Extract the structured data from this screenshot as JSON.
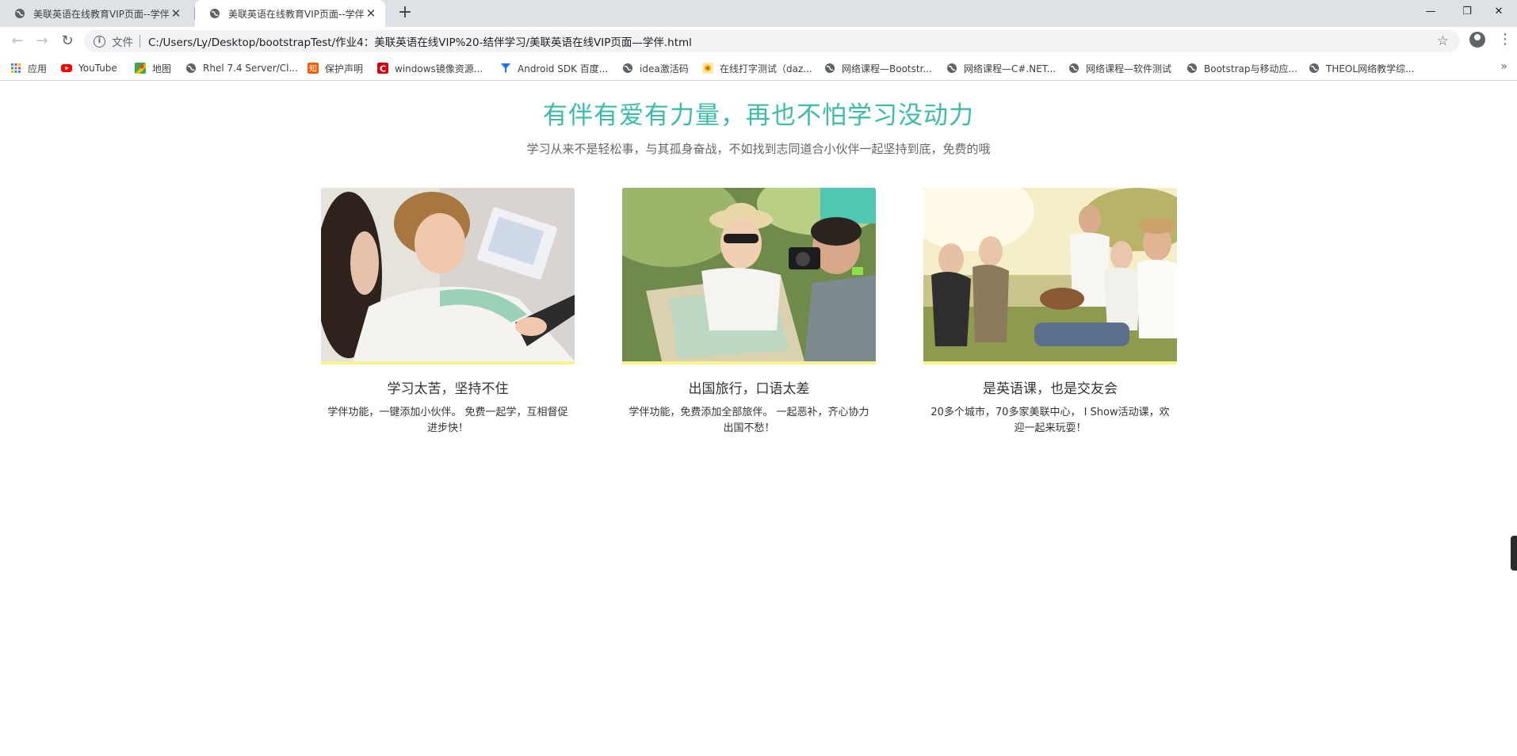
{
  "browser": {
    "tabs": [
      {
        "title": "美联英语在线教育VIP页面--学伴",
        "active": false
      },
      {
        "title": "美联英语在线教育VIP页面--学伴",
        "active": true
      }
    ],
    "new_tab_icon": "plus-icon",
    "window_controls": {
      "minimize": "—",
      "restore": "❐",
      "close": "✕"
    },
    "nav": {
      "back": "←",
      "forward": "→",
      "reload": "↻"
    },
    "address": {
      "info_glyph": "i",
      "scheme_label": "文件",
      "url": "C:/Users/Ly/Desktop/bootstrapTest/作业4：美联英语在线VIP%20-结伴学习/美联英语在线VIP页面—学伴.html"
    },
    "bookmarks": [
      {
        "label": "应用",
        "icon": "apps-grid-icon",
        "color": "#e94235"
      },
      {
        "label": "YouTube",
        "icon": "youtube-icon",
        "color": "#ff0000"
      },
      {
        "label": "地图",
        "icon": "maps-icon",
        "color": "#34a853"
      },
      {
        "label": "Rhel 7.4 Server/Cl...",
        "icon": "globe-icon",
        "color": "#5f6368"
      },
      {
        "label": "保护声明",
        "icon": "shield-icon",
        "color": "#f25c05"
      },
      {
        "label": "windows镜像资源...",
        "icon": "c-logo-icon",
        "color": "#d4000f"
      },
      {
        "label": "Android SDK 百度...",
        "icon": "funnel-icon",
        "color": "#1a73e8"
      },
      {
        "label": "idea激活码",
        "icon": "globe-icon",
        "color": "#5f6368"
      },
      {
        "label": "在线打字测试（daz...",
        "icon": "typing-icon",
        "color": "#f4b400"
      },
      {
        "label": "网络课程—Bootstr...",
        "icon": "globe-icon",
        "color": "#5f6368"
      },
      {
        "label": "网络课程—C#.NET...",
        "icon": "globe-icon",
        "color": "#5f6368"
      },
      {
        "label": "网络课程—软件测试",
        "icon": "globe-icon",
        "color": "#5f6368"
      },
      {
        "label": "Bootstrap与移动应...",
        "icon": "globe-icon",
        "color": "#5f6368"
      },
      {
        "label": "THEOL网络教学综...",
        "icon": "globe-icon",
        "color": "#5f6368"
      }
    ],
    "bookmarks_more": "»"
  },
  "page": {
    "headline": "有伴有爱有力量，再也不怕学习没动力",
    "subline": "学习从来不是轻松事，与其孤身奋战，不如找到志同道合小伙伴一起坚持到底，免费的哦",
    "cards": [
      {
        "title": "学习太苦，坚持不住",
        "desc": "学伴功能，一键添加小伙伴。 免费一起学，互相督促进步快！",
        "photo": "students-studying-photo"
      },
      {
        "title": "出国旅行，口语太差",
        "desc": "学伴功能，免费添加全部旅伴。 一起恶补，齐心协力出国不愁！",
        "photo": "travelers-map-photo"
      },
      {
        "title": "是英语课，也是交友会",
        "desc": "20多个城市，70多家美联中心， I Show活动课，欢迎一起来玩耍！",
        "photo": "friends-park-photo"
      }
    ],
    "colors": {
      "headline": "#3dbba9",
      "card_bar": "#fbf28a"
    }
  }
}
